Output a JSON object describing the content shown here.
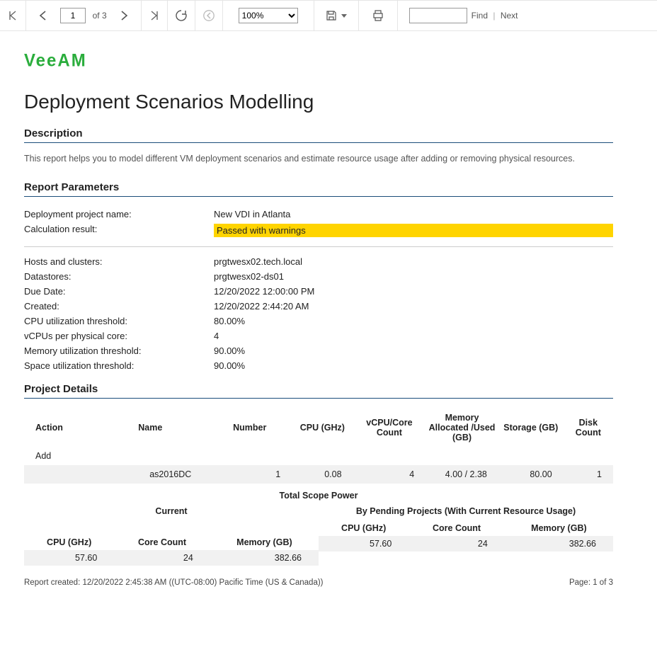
{
  "toolbar": {
    "page_value": "1",
    "of_label": "of",
    "page_count": "3",
    "zoom_value": "100%",
    "find_label": "Find",
    "next_label": "Next"
  },
  "logo_text": "VeeAM",
  "report_title": "Deployment Scenarios Modelling",
  "sections": {
    "description_title": "Description",
    "description_body": "This report helps you to model different VM deployment scenarios and estimate resource usage after adding or removing physical resources.",
    "parameters_title": "Report Parameters",
    "details_title": "Project Details"
  },
  "params_top": [
    {
      "k": "Deployment project name:",
      "v": "New VDI in Atlanta",
      "hl": false
    },
    {
      "k": "Calculation result:",
      "v": "Passed with warnings",
      "hl": true
    }
  ],
  "params_bottom": [
    {
      "k": "Hosts and clusters:",
      "v": "prgtwesx02.tech.local"
    },
    {
      "k": "Datastores:",
      "v": "prgtwesx02-ds01"
    },
    {
      "k": "Due Date:",
      "v": "12/20/2022 12:00:00 PM"
    },
    {
      "k": "Created:",
      "v": "12/20/2022 2:44:20 AM"
    },
    {
      "k": "CPU utilization threshold:",
      "v": "80.00%"
    },
    {
      "k": "vCPUs per physical core:",
      "v": "4"
    },
    {
      "k": "Memory utilization threshold:",
      "v": "90.00%"
    },
    {
      "k": "Space utilization threshold:",
      "v": "90.00%"
    }
  ],
  "details": {
    "headers": {
      "action": "Action",
      "name": "Name",
      "number": "Number",
      "cpu": "CPU (GHz)",
      "vcpu": "vCPU/Core Count",
      "mem": "Memory Allocated /Used (GB)",
      "storage": "Storage (GB)",
      "disk": "Disk Count"
    },
    "group_label": "Add",
    "rows": [
      {
        "name": "as2016DC",
        "number": "1",
        "cpu": "0.08",
        "vcpu": "4",
        "mem": "4.00 / 2.38",
        "storage": "80.00",
        "disk": "1"
      }
    ]
  },
  "scope": {
    "title": "Total Scope Power",
    "current_label": "Current",
    "pending_label": "By Pending Projects (With Current Resource Usage)",
    "cols": {
      "cpu": "CPU (GHz)",
      "core": "Core Count",
      "mem": "Memory (GB)"
    },
    "current": {
      "cpu": "57.60",
      "core": "24",
      "mem": "382.66"
    },
    "pending": {
      "cpu": "57.60",
      "core": "24",
      "mem": "382.66"
    }
  },
  "footer": {
    "created": "Report created: 12/20/2022 2:45:38 AM ((UTC-08:00) Pacific Time (US & Canada))",
    "page": "Page: 1 of 3"
  }
}
